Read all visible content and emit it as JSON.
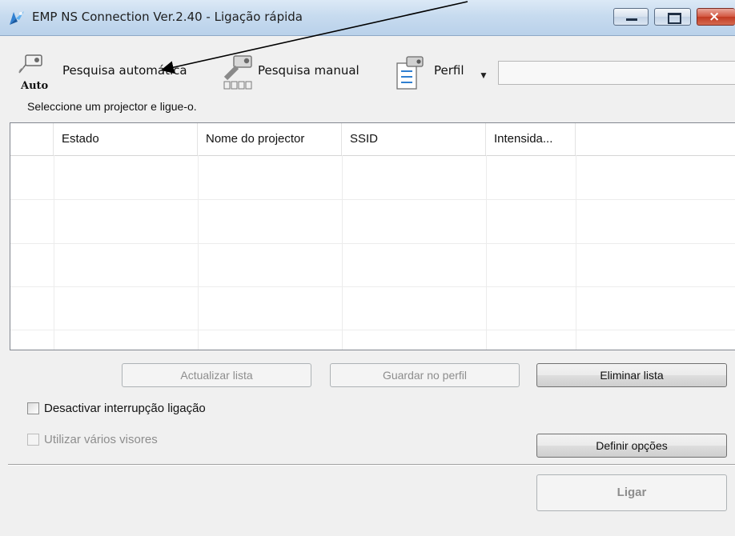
{
  "window": {
    "title": "EMP NS Connection Ver.2.40 - Ligação rápida",
    "close_glyph": "×"
  },
  "toolbar": {
    "auto_search_label": "Pesquisa automática",
    "auto_icon_text": "Auto",
    "manual_search_label": "Pesquisa manual",
    "profile_label": "Perfil",
    "profile_dropdown_glyph": "▼",
    "profile_value": ""
  },
  "instruction": "Seleccione um projector e ligue-o.",
  "projector_list": {
    "columns": [
      "",
      "Estado",
      "Nome do projector",
      "SSID",
      "Intensida..."
    ],
    "rows": []
  },
  "buttons": {
    "update_list": "Actualizar lista",
    "save_profile": "Guardar no perfil",
    "clear_list": "Eliminar lista",
    "set_options": "Definir opções",
    "connect": "Ligar"
  },
  "checkboxes": {
    "disable_interrupt": {
      "label": "Desactivar interrupção ligação",
      "checked": false,
      "enabled": true
    },
    "multi_display": {
      "label": "Utilizar vários visores",
      "checked": false,
      "enabled": false
    }
  }
}
